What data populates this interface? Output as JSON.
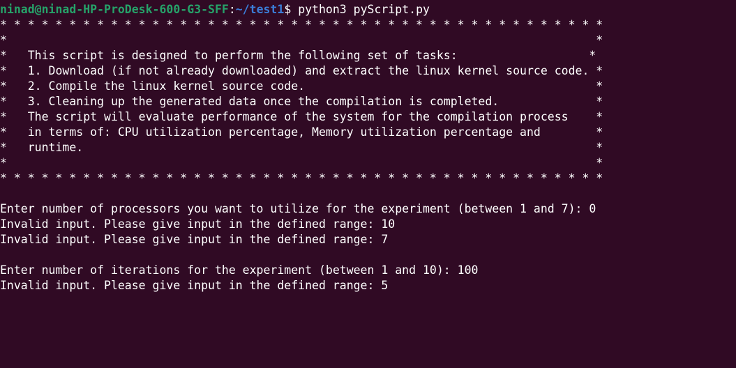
{
  "prompt": {
    "user_host": "ninad@ninad-HP-ProDesk-600-G3-SFF",
    "colon": ":",
    "path": "~/test1",
    "dollar": "$ ",
    "command": "python3 pyScript.py"
  },
  "colors": {
    "background": "#300a24",
    "prompt_user": "#26a269",
    "prompt_path": "#3b7dd8",
    "text": "#ffffff"
  },
  "banner": [
    "* * * * * * * * * * * * * * * * * * * * * * * * * * * * * * * * * * * * * * * * * * * *",
    "*                                                                                     *",
    "*   This script is designed to perform the following set of tasks:                   *",
    "*   1. Download (if not already downloaded) and extract the linux kernel source code. *",
    "*   2. Compile the linux kernel source code.                                          *",
    "*   3. Cleaning up the generated data once the compilation is completed.              *",
    "*   The script will evaluate performance of the system for the compilation process    *",
    "*   in terms of: CPU utilization percentage, Memory utilization percentage and        *",
    "*   runtime.                                                                          *",
    "*                                                                                     *",
    "* * * * * * * * * * * * * * * * * * * * * * * * * * * * * * * * * * * * * * * * * * * *"
  ],
  "output": [
    "",
    "Enter number of processors you want to utilize for the experiment (between 1 and 7): 0",
    "Invalid input. Please give input in the defined range: 10",
    "Invalid input. Please give input in the defined range: 7",
    "",
    "Enter number of iterations for the experiment (between 1 and 10): 100",
    "Invalid input. Please give input in the defined range: 5"
  ]
}
